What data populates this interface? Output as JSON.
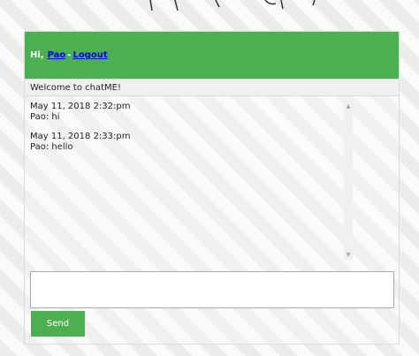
{
  "header": {
    "greeting": "Hi,",
    "username": "Pao",
    "separator": "-",
    "logout_label": "Logout"
  },
  "welcome_text": "Welcome to chatME!",
  "messages": [
    {
      "timestamp": "May 11, 2018 2:32:pm",
      "text": "Pao: hi"
    },
    {
      "timestamp": "May 11, 2018 2:33:pm",
      "text": "Pao: hello"
    }
  ],
  "composer": {
    "input_value": "",
    "send_label": "Send"
  },
  "colors": {
    "accent": "#4caf50",
    "link": "#0000ee"
  }
}
